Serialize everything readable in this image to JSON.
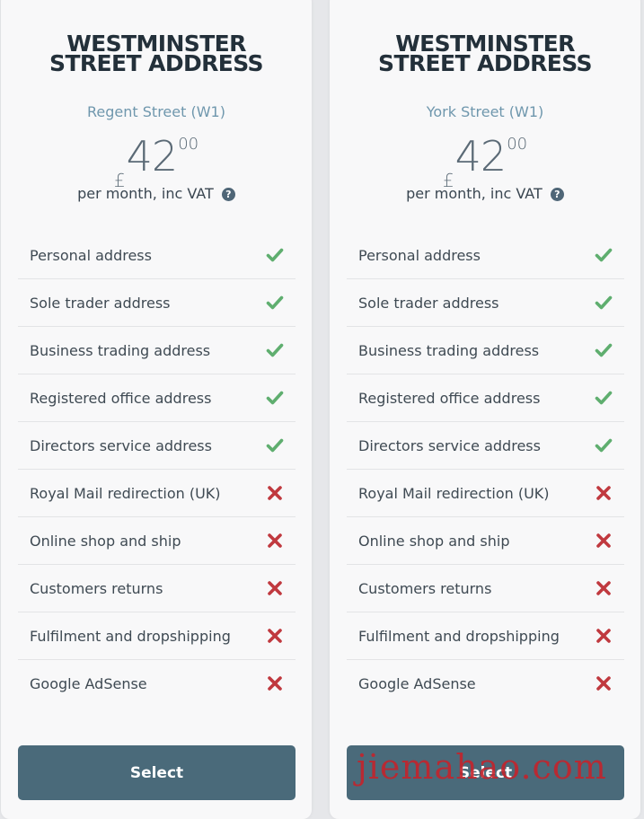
{
  "plans": [
    {
      "title_line1": "WESTMINSTER",
      "title_line2": "STREET ADDRESS",
      "location": "Regent Street (W1)",
      "price": {
        "currency": "£",
        "amount": "42",
        "cents": "00"
      },
      "period": "per month, inc VAT",
      "button_label": "Select",
      "features": [
        {
          "label": "Personal address",
          "included": true
        },
        {
          "label": "Sole trader address",
          "included": true
        },
        {
          "label": "Business trading address",
          "included": true
        },
        {
          "label": "Registered office address",
          "included": true
        },
        {
          "label": "Directors service address",
          "included": true
        },
        {
          "label": "Royal Mail redirection (UK)",
          "included": false
        },
        {
          "label": "Online shop and ship",
          "included": false
        },
        {
          "label": "Customers returns",
          "included": false
        },
        {
          "label": "Fulfilment and dropshipping",
          "included": false
        },
        {
          "label": "Google AdSense",
          "included": false
        }
      ]
    },
    {
      "title_line1": "WESTMINSTER",
      "title_line2": "STREET ADDRESS",
      "location": "York Street (W1)",
      "price": {
        "currency": "£",
        "amount": "42",
        "cents": "00"
      },
      "period": "per month, inc VAT",
      "button_label": "Select",
      "features": [
        {
          "label": "Personal address",
          "included": true
        },
        {
          "label": "Sole trader address",
          "included": true
        },
        {
          "label": "Business trading address",
          "included": true
        },
        {
          "label": "Registered office address",
          "included": true
        },
        {
          "label": "Directors service address",
          "included": true
        },
        {
          "label": "Royal Mail redirection (UK)",
          "included": false
        },
        {
          "label": "Online shop and ship",
          "included": false
        },
        {
          "label": "Customers returns",
          "included": false
        },
        {
          "label": "Fulfilment and dropshipping",
          "included": false
        },
        {
          "label": "Google AdSense",
          "included": false
        }
      ]
    }
  ],
  "icons": {
    "help": "question-circle-icon",
    "included": "check-icon",
    "excluded": "cross-icon"
  },
  "colors": {
    "check": "#5fae6f",
    "cross": "#c0393f",
    "button": "#4a6a7a",
    "accent": "#6f97ad"
  },
  "watermark": "jiemahao.com"
}
